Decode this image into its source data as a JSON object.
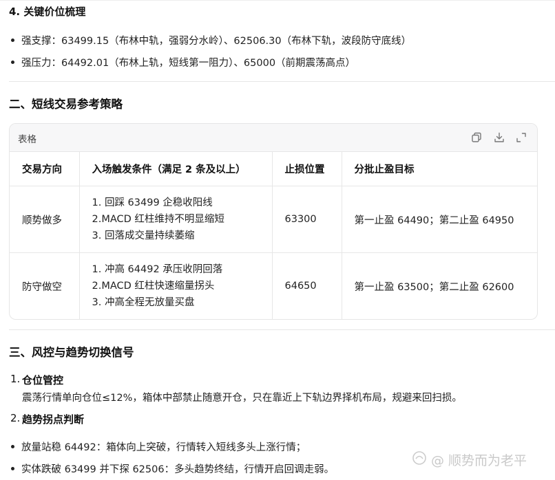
{
  "section4": {
    "title": "4. 关键价位梳理",
    "bullets": [
      "强支撑：63499.15（布林中轨，强弱分水岭）、62506.30（布林下轨，波段防守底线）",
      "强压力：64492.01（布林上轨，短线第一阻力）、65000（前期震荡高点）"
    ]
  },
  "section2": {
    "title": "二、短线交易参考策略",
    "table": {
      "caption": "表格",
      "headers": [
        "交易方向",
        "入场触发条件（满足 2 条及以上）",
        "止损位置",
        "分批止盈目标"
      ],
      "rows": [
        {
          "direction": "顺势做多",
          "conditions": [
            "1. 回踩 63499 企稳收阳线",
            "2.MACD 红柱维持不明显缩短",
            "3. 回落成交量持续萎缩"
          ],
          "stop": "63300",
          "targets": "第一止盈 64490；第二止盈 64950"
        },
        {
          "direction": "防守做空",
          "conditions": [
            "1. 冲高 64492 承压收阴回落",
            "2.MACD 红柱快速缩量拐头",
            "3. 冲高全程无放量买盘"
          ],
          "stop": "64650",
          "targets": "第一止盈 63500；第二止盈 62600"
        }
      ]
    }
  },
  "section3": {
    "title": "三、风控与趋势切换信号",
    "items": [
      {
        "num": "1.",
        "title": "仓位管控",
        "body": "震荡行情单向仓位≤12%，箱体中部禁止随意开仓，只在靠近上下轨边界择机布局，规避来回扫损。"
      },
      {
        "num": "2.",
        "title": "趋势拐点判断"
      }
    ],
    "bullets": [
      "放量站稳 64492：箱体向上突破，行情转入短线多头上涨行情；",
      "实体跌破 63499 并下探 62506：多头趋势终结，行情开启回调走弱。"
    ]
  },
  "watermark": "@ 顺势而为老平"
}
